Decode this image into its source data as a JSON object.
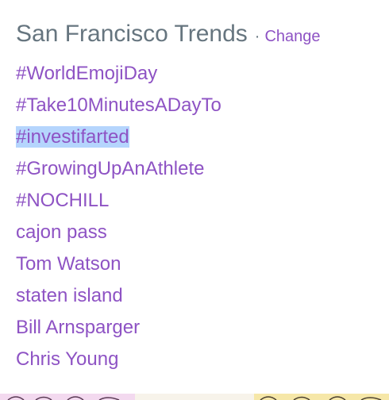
{
  "header": {
    "title": "San Francisco Trends",
    "separator": "·",
    "change_label": "Change"
  },
  "trends": [
    "#WorldEmojiDay",
    "#Take10MinutesADayTo",
    "#investifarted",
    "#GrowingUpAnAthlete",
    "#NOCHILL",
    "cajon pass",
    "Tom Watson",
    "staten island",
    "Bill Arnsparger",
    "Chris Young"
  ],
  "selected_trend": "#investifarted",
  "colors": {
    "link": "#8e53c4",
    "title": "#66757f",
    "selection": "#b5d5fd"
  }
}
